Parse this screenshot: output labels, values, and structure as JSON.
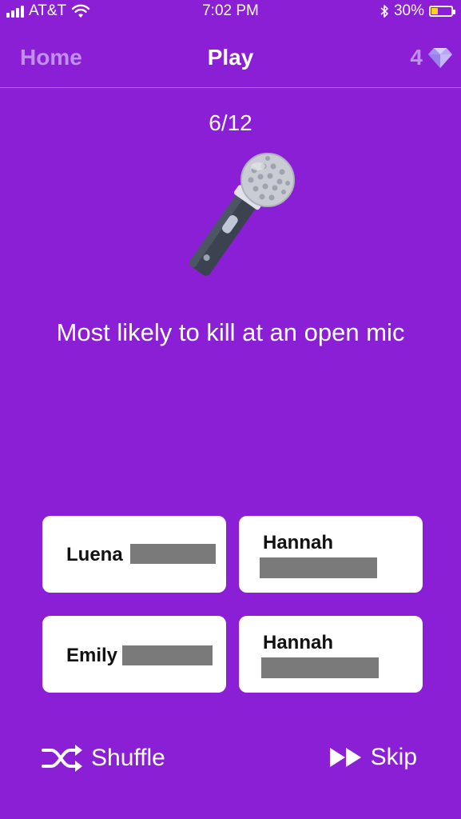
{
  "status_bar": {
    "carrier": "AT&T",
    "time": "7:02 PM",
    "battery_percent": "30%",
    "battery_level": 0.3,
    "battery_color": "#ffd21f"
  },
  "nav": {
    "home_label": "Home",
    "title": "Play",
    "gem_count": "4"
  },
  "game": {
    "progress": "6/12",
    "icon": "microphone-icon",
    "prompt": "Most likely to kill at an open mic"
  },
  "answers": [
    {
      "name": "Luena"
    },
    {
      "name": "Hannah"
    },
    {
      "name": "Emily"
    },
    {
      "name": "Hannah"
    }
  ],
  "actions": {
    "shuffle_label": "Shuffle",
    "skip_label": "Skip"
  },
  "colors": {
    "background": "#8a1fd6",
    "nav_inactive": "#c18ff0",
    "card": "#ffffff",
    "redaction": "#7a7a7a"
  }
}
